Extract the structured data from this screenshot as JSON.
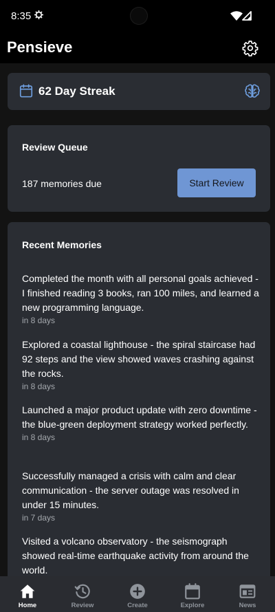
{
  "status_bar": {
    "time": "8:35",
    "icons": [
      "gear-icon",
      "wifi-icon",
      "signal-icon"
    ]
  },
  "app_bar": {
    "title": "Pensieve",
    "settings_icon": "gear-icon"
  },
  "streak": {
    "label": "62 Day Streak",
    "left_icon": "calendar-icon",
    "right_icon": "brain-icon",
    "accent": "#6f9fe0"
  },
  "review_queue": {
    "title": "Review Queue",
    "due_text": "187 memories due",
    "button_label": "Start Review",
    "button_color": "#6f96d4"
  },
  "recent_memories": {
    "title": "Recent Memories",
    "items": [
      {
        "text": "Completed the month with all personal goals achieved - I finished reading 3 books, ran 100 miles, and learned a new programming language.",
        "when": "in 8 days"
      },
      {
        "text": "Explored a coastal lighthouse - the spiral staircase had 92 steps and the view showed waves crashing against the rocks.",
        "when": "in 8 days"
      },
      {
        "text": "Launched a major product update with zero downtime - the blue-green deployment strategy worked perfectly.",
        "when": "in 8 days"
      },
      {
        "text": "Successfully managed a crisis with calm and clear communication - the server outage was resolved in under 15 minutes.",
        "when": "in 7 days"
      },
      {
        "text": "Visited a volcano observatory - the seismograph showed real-time earthquake activity from around the world.",
        "when": ""
      }
    ]
  },
  "bottom_nav": {
    "items": [
      {
        "label": "Home",
        "icon": "home-icon",
        "active": true
      },
      {
        "label": "Review",
        "icon": "history-icon",
        "active": false
      },
      {
        "label": "Create",
        "icon": "add-circle-icon",
        "active": false
      },
      {
        "label": "Explore",
        "icon": "calendar-icon",
        "active": false
      },
      {
        "label": "News",
        "icon": "newspaper-icon",
        "active": false
      }
    ]
  }
}
